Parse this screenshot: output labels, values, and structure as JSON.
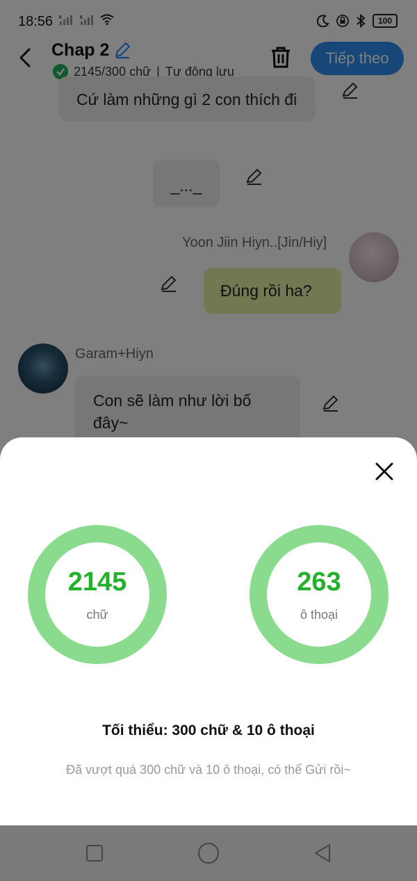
{
  "status_bar": {
    "time": "18:56",
    "battery": "100",
    "icons": [
      "signal-x-icon",
      "signal-x-icon",
      "wifi-icon",
      "moon-icon",
      "lock-icon",
      "bluetooth-icon",
      "battery-icon"
    ]
  },
  "header": {
    "title": "Chap 2",
    "word_count": "2145/300 chữ",
    "separator": "|",
    "autosave": "Tự động lưu",
    "next_label": "Tiếp theo",
    "accent_color": "#2f8cf0"
  },
  "chat": {
    "messages": [
      {
        "text": "Cứ làm những gì 2 con thích đi"
      },
      {
        "text": "_..._"
      },
      {
        "sender": "Yoon Jiin Hiyn..[Jin/Hiy]",
        "text": "Đúng rồi ha?"
      },
      {
        "sender": "Garam+Hiyn",
        "text": "Con sẽ làm như lời bố đây~"
      }
    ]
  },
  "sheet": {
    "words_value": "2145",
    "words_unit": "chữ",
    "dialogs_value": "263",
    "dialogs_unit": "ô thoại",
    "minimum_label": "Tối thiểu: 300 chữ & 10 ô thoại",
    "status_message": "Đã vượt quá 300 chữ và 10 ô thoại, có thể Gửi rồi~",
    "ring_color": "#8bdb8e",
    "number_color": "#23b12d"
  },
  "nav": {
    "icons": [
      "recent-apps-icon",
      "home-icon",
      "back-nav-icon"
    ]
  }
}
